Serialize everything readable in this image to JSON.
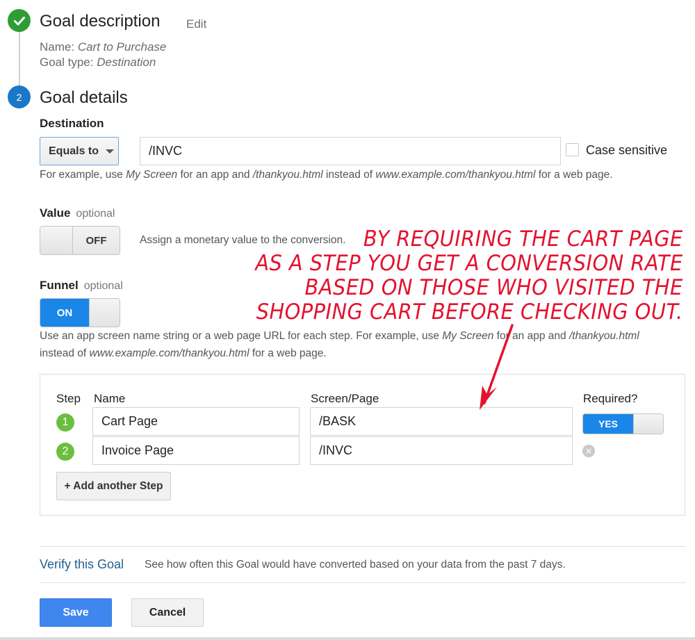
{
  "stepper": {
    "step1": {
      "title": "Goal description",
      "edit_label": "Edit",
      "name_label": "Name:",
      "name_value": "Cart to Purchase",
      "type_label": "Goal type:",
      "type_value": "Destination",
      "status_icon": "check-icon"
    },
    "step2": {
      "number": "2",
      "title": "Goal details"
    }
  },
  "destination": {
    "label": "Destination",
    "match_type": "Equals to",
    "value": "/INVC",
    "case_sensitive_label": "Case sensitive",
    "case_sensitive_checked": false,
    "hint_parts": [
      "For example, use ",
      "My Screen",
      " for an app and ",
      "/thankyou.html",
      " instead of ",
      "www.example.com/thankyou.html",
      " for a web page."
    ]
  },
  "value_section": {
    "label": "Value",
    "optional": "optional",
    "toggle_state": "OFF",
    "description": "Assign a monetary value to the conversion."
  },
  "funnel_section": {
    "label": "Funnel",
    "optional": "optional",
    "toggle_state": "ON",
    "hint_line1_parts": [
      "Use an app screen name string or a web page URL for each step. For example, use ",
      "My Screen",
      " for an app and ",
      "/thankyou.html"
    ],
    "hint_line2_parts": [
      "instead of ",
      "www.example.com/thankyou.html",
      " for a web page."
    ],
    "columns": {
      "step": "Step",
      "name": "Name",
      "screen": "Screen/Page",
      "required": "Required?"
    },
    "steps": [
      {
        "number": "1",
        "name": "Cart Page",
        "screen": "/BASK",
        "required": "YES"
      },
      {
        "number": "2",
        "name": "Invoice Page",
        "screen": "/INVC"
      }
    ],
    "add_step_label": "+ Add another Step"
  },
  "annotation": {
    "lines": [
      "BY REQUIRING THE CART PAGE",
      "AS A STEP YOU GET A CONVERSION RATE",
      "BASED ON THOSE WHO VISITED THE",
      "SHOPPING CART BEFORE CHECKING OUT."
    ],
    "color": "#e3122f"
  },
  "verify": {
    "link": "Verify this Goal",
    "description": "See how often this Goal would have converted based on your data from the past 7 days."
  },
  "actions": {
    "save": "Save",
    "cancel": "Cancel"
  },
  "colors": {
    "done_green": "#2f9c36",
    "active_blue": "#1b78c8",
    "toggle_blue": "#1a86e8",
    "step_badge_green": "#6abf3f",
    "save_blue": "#3f87ef",
    "link_blue": "#1f5f8f"
  }
}
